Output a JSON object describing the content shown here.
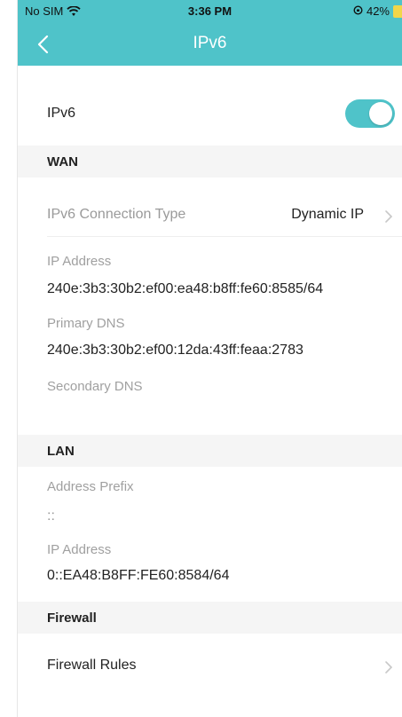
{
  "status_bar": {
    "carrier": "No SIM",
    "time": "3:36 PM",
    "battery": "42%"
  },
  "nav": {
    "title": "IPv6"
  },
  "ipv6_toggle": {
    "label": "IPv6",
    "state": "on"
  },
  "wan": {
    "header": "WAN",
    "connection_type_label": "IPv6 Connection Type",
    "connection_type_value": "Dynamic IP",
    "ip_address_label": "IP Address",
    "ip_address_value": "240e:3b3:30b2:ef00:ea48:b8ff:fe60:8585/64",
    "primary_dns_label": "Primary DNS",
    "primary_dns_value": "240e:3b3:30b2:ef00:12da:43ff:feaa:2783",
    "secondary_dns_label": "Secondary DNS",
    "secondary_dns_value": ""
  },
  "lan": {
    "header": "LAN",
    "address_prefix_label": "Address Prefix",
    "address_prefix_value": "::",
    "ip_address_label": "IP Address",
    "ip_address_value": "0::EA48:B8FF:FE60:8584/64"
  },
  "firewall": {
    "header": "Firewall",
    "rules_label": "Firewall Rules"
  },
  "colors": {
    "accent": "#4fc3c9",
    "section_bg": "#f5f5f5",
    "muted_text": "#a0a0a0"
  }
}
